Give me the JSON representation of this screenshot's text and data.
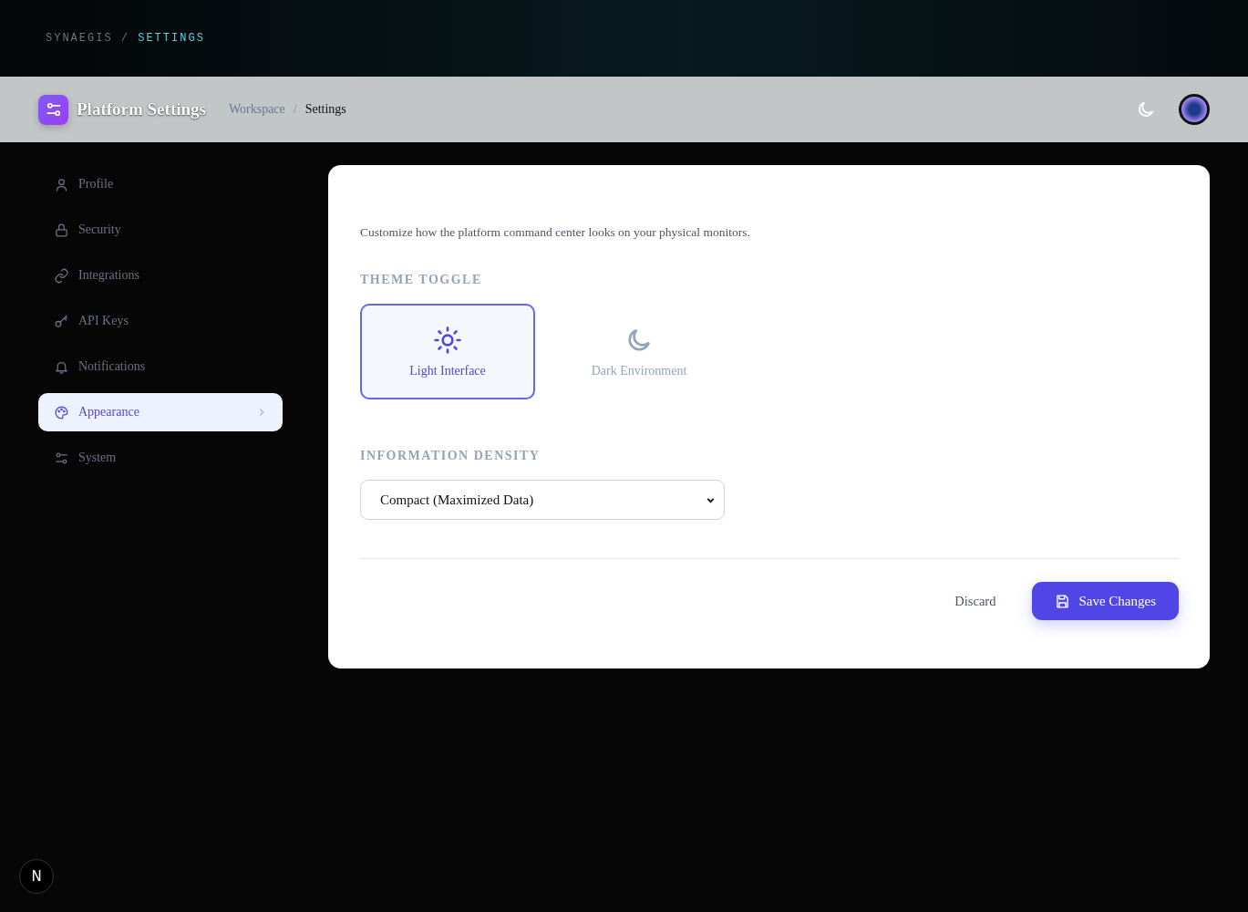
{
  "top_breadcrumb": {
    "root": "SYNAEGIS",
    "separator": "/",
    "current": "SETTINGS"
  },
  "header": {
    "title": "Platform Settings",
    "breadcrumb": [
      "Workspace",
      "Settings"
    ],
    "separator": "/"
  },
  "sidebar": {
    "items": [
      {
        "label": "Profile",
        "selected": false
      },
      {
        "label": "Security",
        "selected": false
      },
      {
        "label": "Integrations",
        "selected": false
      },
      {
        "label": "API Keys",
        "selected": false
      },
      {
        "label": "Notifications",
        "selected": false
      },
      {
        "label": "Appearance",
        "selected": true
      },
      {
        "label": "System",
        "selected": false
      }
    ]
  },
  "panel": {
    "description": "Customize how the platform command center looks on your physical monitors.",
    "theme_heading": "THEME TOGGLE",
    "theme_options": [
      {
        "label": "Light Interface",
        "kind": "sun",
        "selected": true
      },
      {
        "label": "Dark Environment",
        "kind": "moon",
        "selected": false
      }
    ],
    "density_heading": "INFORMATION DENSITY",
    "density_select": {
      "value": "Compact (Maximized Data)"
    },
    "buttons": {
      "discard": "Discard",
      "save": "Save Changes"
    }
  },
  "dev_badge": {
    "label": "N"
  }
}
